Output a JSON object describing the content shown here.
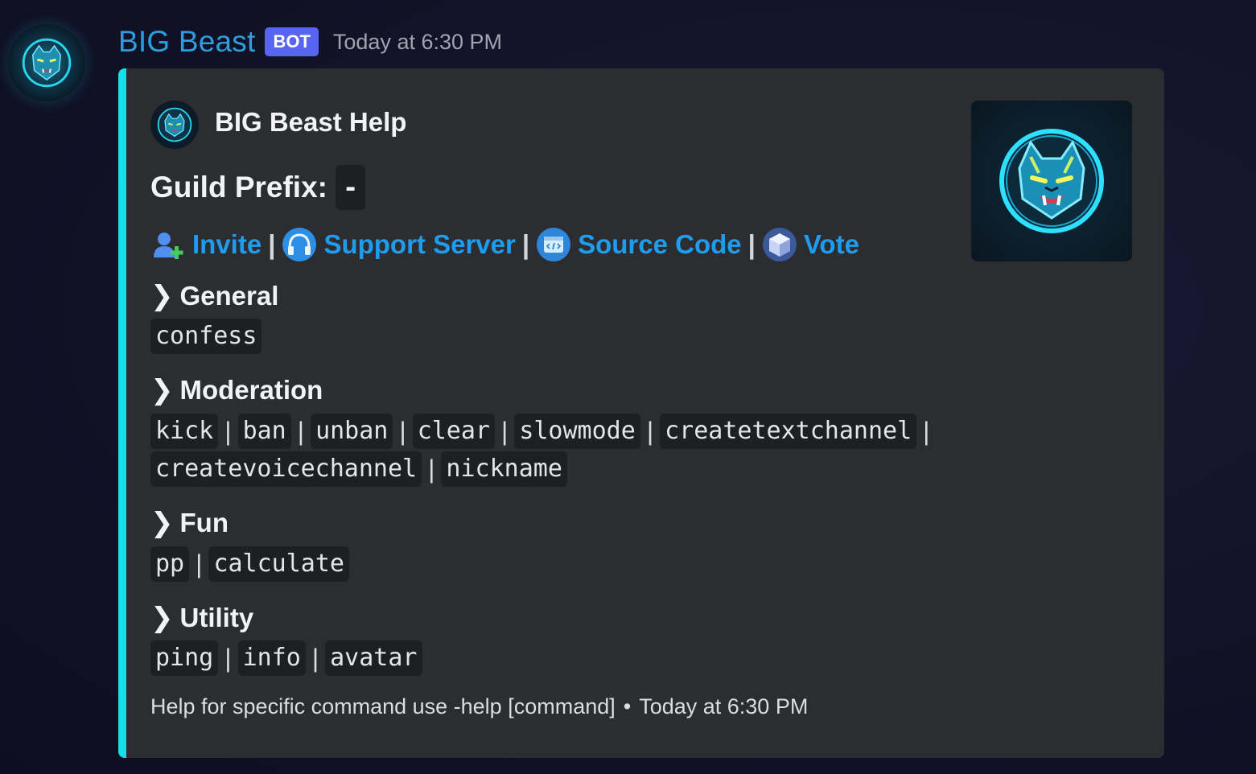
{
  "message": {
    "username": "BIG Beast",
    "badge": "BOT",
    "timestamp": "Today at 6:30 PM",
    "username_color": "#2f9cdc"
  },
  "embed": {
    "accent_color": "#17dfe9",
    "author": "BIG Beast Help",
    "prefix_label": "Guild Prefix:",
    "prefix_value": "-",
    "links": [
      {
        "label": "Invite",
        "icon": "add-user-icon"
      },
      {
        "label": "Support Server",
        "icon": "headset-icon"
      },
      {
        "label": "Source Code",
        "icon": "code-window-icon"
      },
      {
        "label": "Vote",
        "icon": "cube-icon"
      }
    ],
    "separator": "|",
    "sections": [
      {
        "name": "General",
        "rows": [
          [
            "confess"
          ]
        ]
      },
      {
        "name": "Moderation",
        "rows": [
          [
            "kick",
            "ban",
            "unban",
            "clear",
            "slowmode",
            "createtextchannel"
          ],
          [
            "createvoicechannel",
            "nickname"
          ]
        ]
      },
      {
        "name": "Fun",
        "rows": [
          [
            "pp",
            "calculate"
          ]
        ]
      },
      {
        "name": "Utility",
        "rows": [
          [
            "ping",
            "info",
            "avatar"
          ]
        ]
      }
    ],
    "footer_text": "Help for specific command use -help [command]",
    "footer_dot": "•",
    "footer_time": "Today at 6:30 PM"
  }
}
